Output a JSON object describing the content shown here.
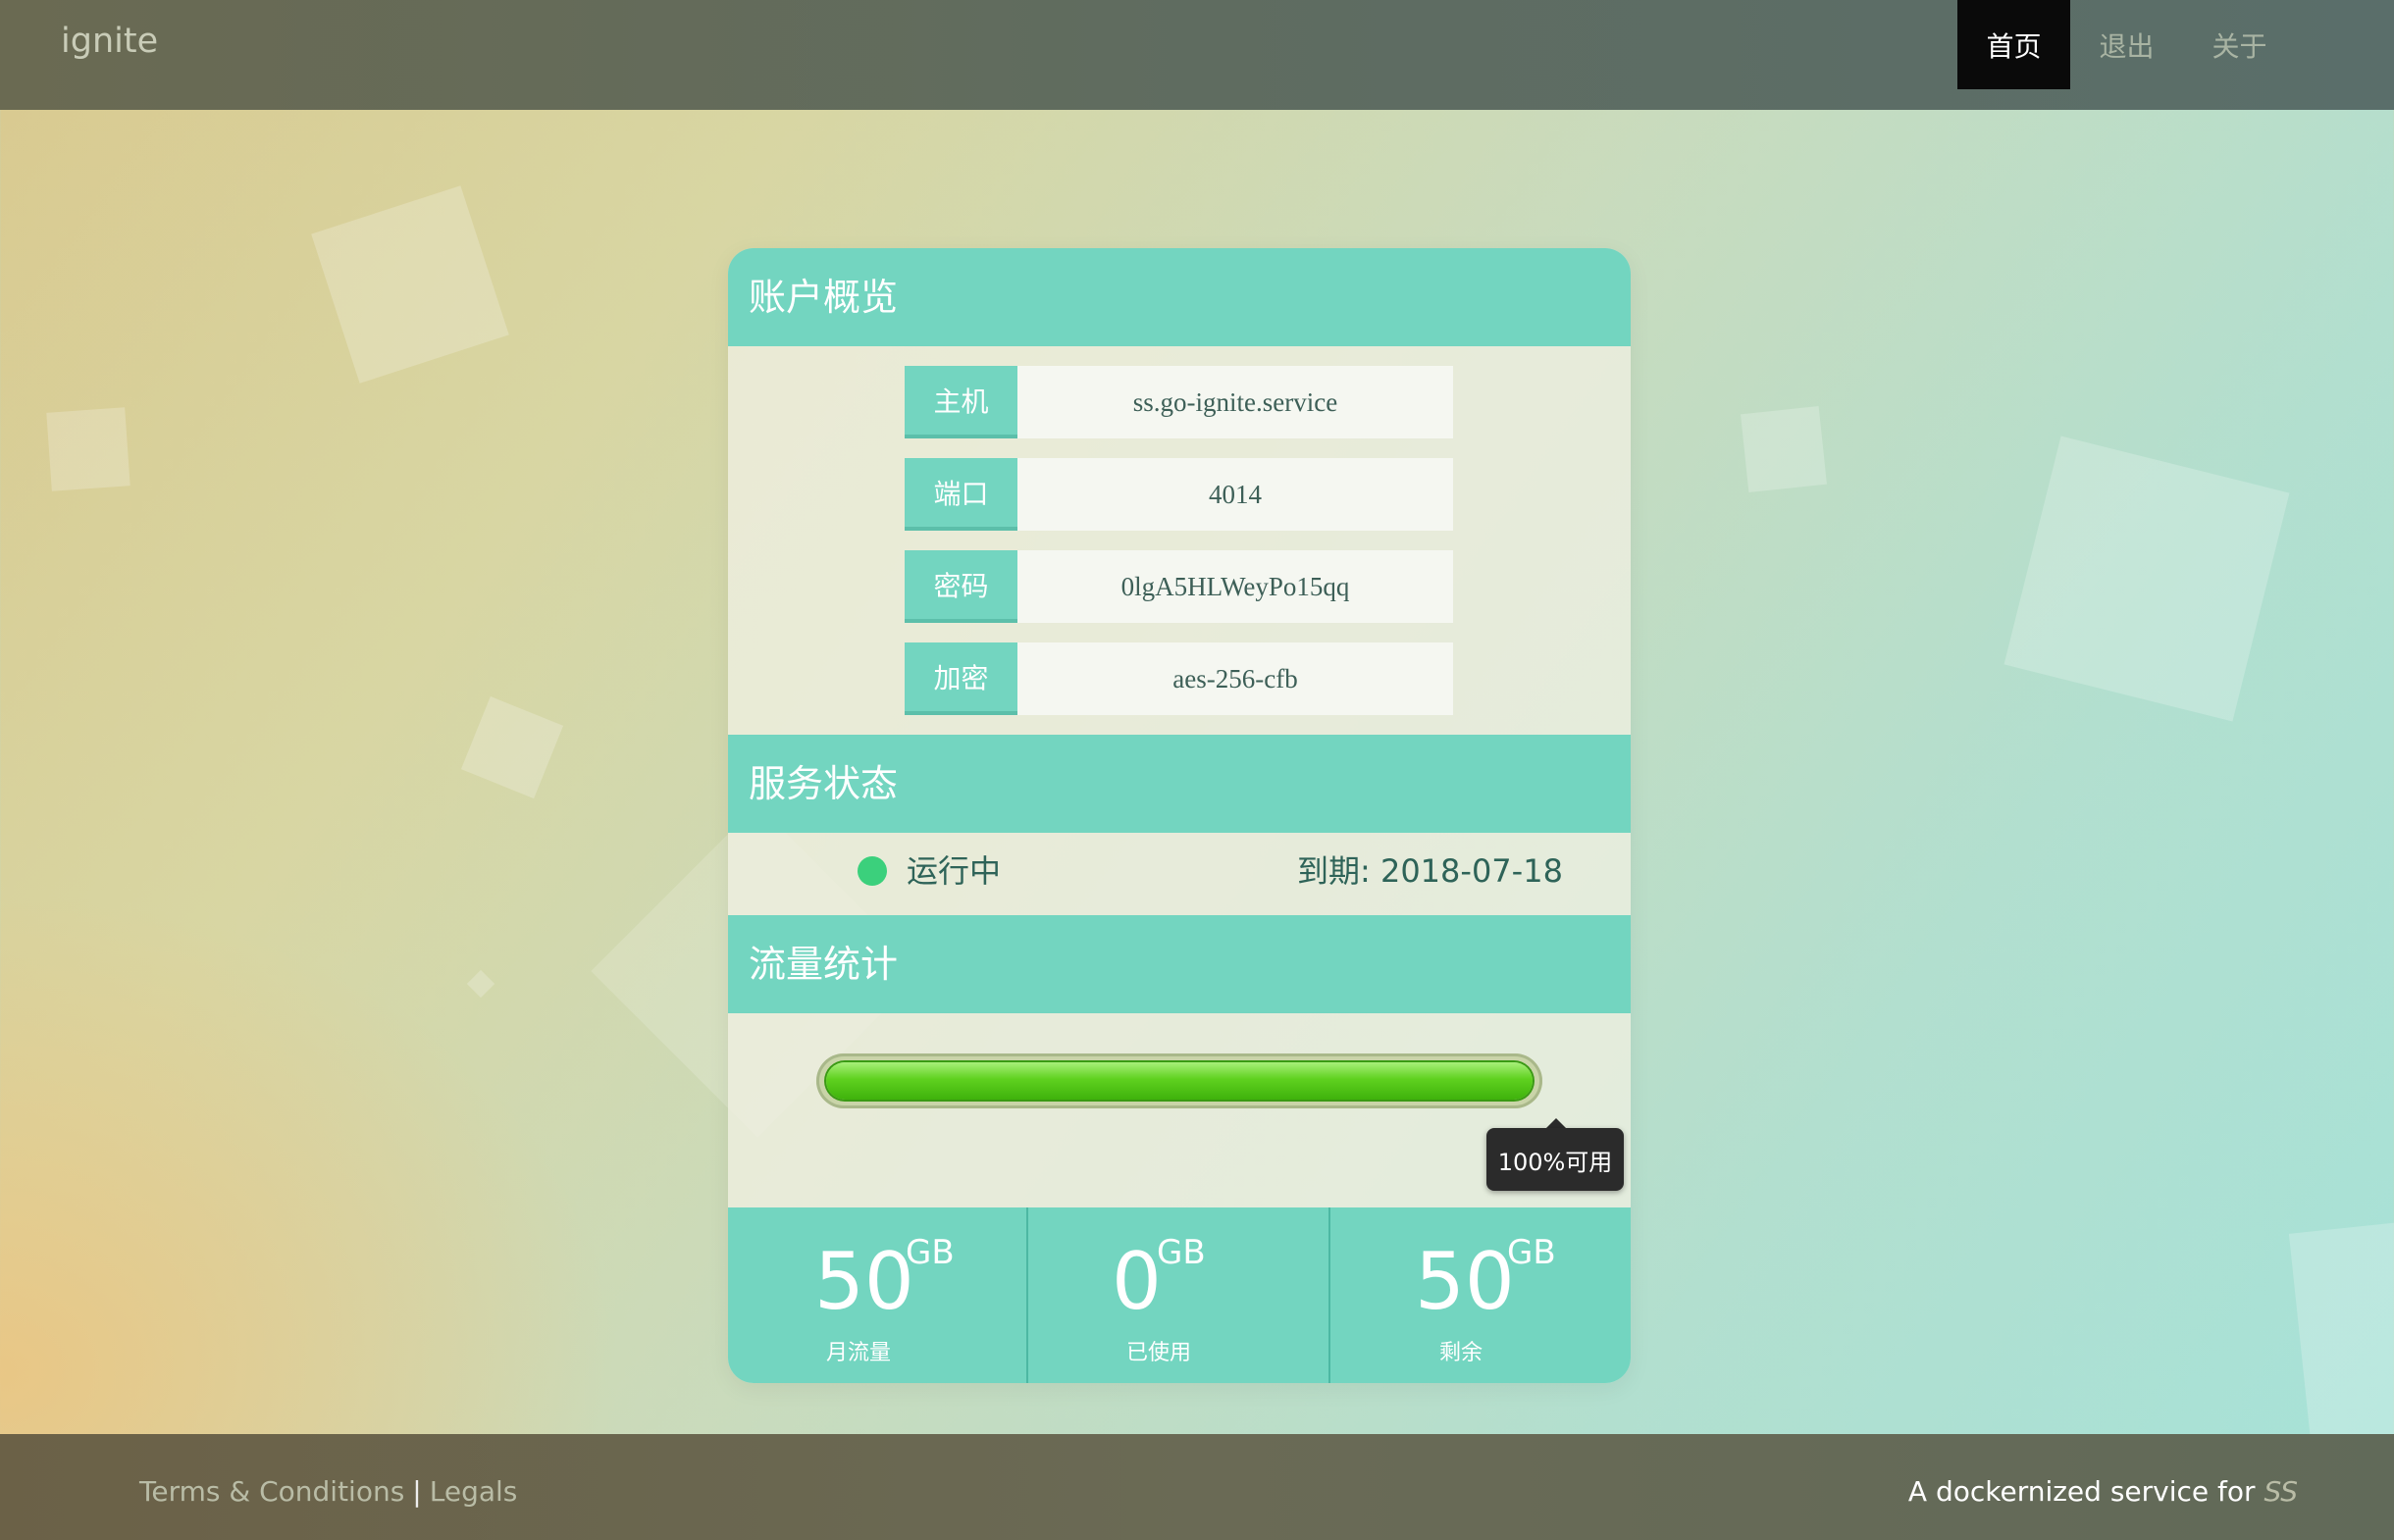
{
  "header": {
    "brand": "ignite",
    "nav": [
      {
        "label": "首页",
        "active": true
      },
      {
        "label": "退出",
        "active": false
      },
      {
        "label": "关于",
        "active": false
      }
    ]
  },
  "account": {
    "title": "账户概览",
    "fields": [
      {
        "label": "主机",
        "value": "ss.go-ignite.service"
      },
      {
        "label": "端口",
        "value": "4014"
      },
      {
        "label": "密码",
        "value": "0lgA5HLWeyPo15qq"
      },
      {
        "label": "加密",
        "value": "aes-256-cfb"
      }
    ]
  },
  "service": {
    "title": "服务状态",
    "status": "运行中",
    "status_color": "#3bd07c",
    "expire": "到期: 2018-07-18"
  },
  "traffic": {
    "title": "流量统计",
    "available_percent": 100,
    "tooltip": "100%可用",
    "stats": [
      {
        "value": "50",
        "unit": "GB",
        "label": "月流量"
      },
      {
        "value": "0",
        "unit": "GB",
        "label": "已使用"
      },
      {
        "value": "50",
        "unit": "GB",
        "label": "剩余"
      }
    ]
  },
  "footer": {
    "terms": "Terms & Conditions",
    "separator": "|",
    "legals": "Legals",
    "tagline": "A dockernized service for",
    "tagline_link": "SS"
  },
  "colors": {
    "accent": "#73d5c0",
    "nav_active_bg": "#0a0a0a",
    "status_running": "#3bd07c",
    "progress_green": "#5fd11f"
  }
}
